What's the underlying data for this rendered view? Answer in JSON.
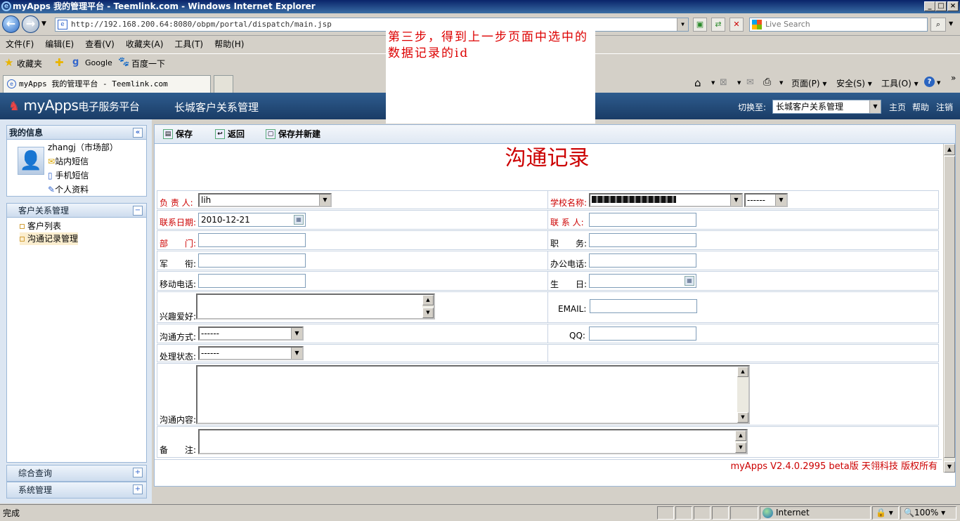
{
  "window": {
    "title": "myApps 我的管理平台 - Teemlink.com - Windows Internet Explorer"
  },
  "browser": {
    "url": "http://192.168.200.64:8080/obpm/portal/dispatch/main.jsp",
    "search_placeholder": "Live Search",
    "menu": [
      "文件(F)",
      "编辑(E)",
      "查看(V)",
      "收藏夹(A)",
      "工具(T)",
      "帮助(H)"
    ],
    "favorites_label": "收藏夹",
    "fav_links": [
      "Google",
      "百度一下"
    ],
    "tab_title": "myApps 我的管理平台 - Teemlink.com",
    "cmd": {
      "page": "页面(P)",
      "safety": "安全(S)",
      "tools": "工具(O)"
    },
    "status_text": "完成",
    "zone": "Internet",
    "zoom": "100%"
  },
  "annotation": "第三步，得到上一步页面中选中的数据记录的id",
  "app": {
    "logo_text": "myApps",
    "logo_sub": "电子服务平台",
    "system_name": "长城客户关系管理",
    "switch_label": "切换至:",
    "switch_value": "长城客户关系管理",
    "links": [
      "主页",
      "帮助",
      "注销"
    ]
  },
  "sidebar": {
    "info_title": "我的信息",
    "user": "zhangj（市场部）",
    "info_links": [
      "站内短信",
      "手机短信",
      "个人资料"
    ],
    "crm_title": "客户关系管理",
    "crm_items": [
      "客户列表",
      "沟通记录管理"
    ],
    "query_title": "综合查询",
    "system_title": "系统管理"
  },
  "toolbar": {
    "save": "保存",
    "back": "返回",
    "save_new": "保存并新建"
  },
  "form": {
    "title": "沟通记录",
    "owner_label": "负 责 人:",
    "owner_value": "lih",
    "school_label": "学校名称:",
    "school_sub_value": "------",
    "contact_date_label": "联系日期:",
    "contact_date_value": "2010-12-21",
    "contact_person_label": "联 系 人:",
    "dept_label": "部　　门:",
    "position_label": "职　　务:",
    "rank_label": "军　　衔:",
    "office_phone_label": "办公电话:",
    "mobile_label": "移动电话:",
    "birthday_label": "生　　日:",
    "hobby_label": "兴趣爱好:",
    "email_label": "EMAIL:",
    "method_label": "沟通方式:",
    "method_value": "------",
    "qq_label": "QQ:",
    "status_label": "处理状态:",
    "status_value": "------",
    "content_label": "沟通内容:",
    "remark_label": "备　　注:"
  },
  "footer": "myApps V2.4.0.2995 beta版  天翎科技  版权所有"
}
